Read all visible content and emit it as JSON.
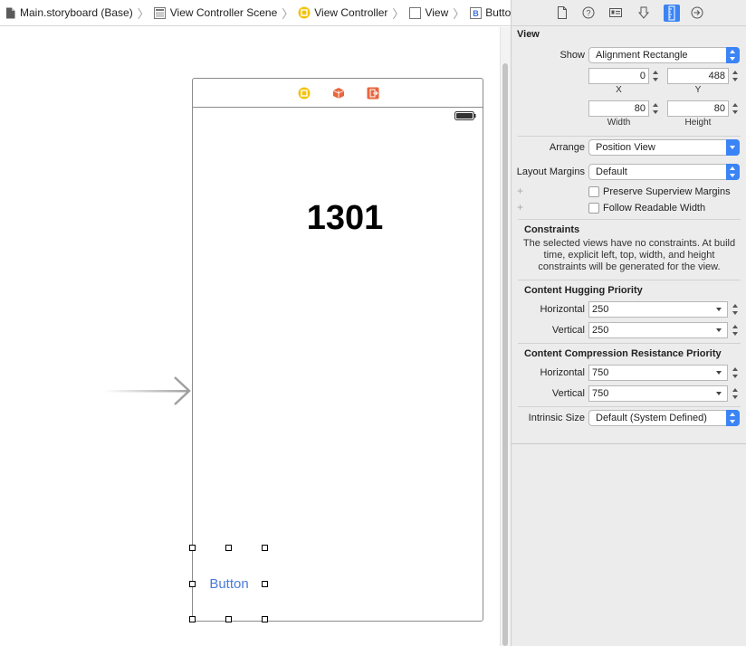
{
  "breadcrumb": {
    "items": [
      {
        "label": "Main.storyboard (Base)",
        "icon": "storyboard-file-icon"
      },
      {
        "label": "View Controller Scene",
        "icon": "scene-icon"
      },
      {
        "label": "View Controller",
        "icon": "view-controller-icon"
      },
      {
        "label": "View",
        "icon": "view-icon"
      },
      {
        "label": "Button",
        "icon": "button-b-icon"
      }
    ]
  },
  "canvas": {
    "counter_text": "1301",
    "button_text": "Button"
  },
  "inspector": {
    "toolbar_icons": [
      "file-inspector-icon",
      "quick-help-icon",
      "identity-inspector-icon",
      "attributes-inspector-icon",
      "size-inspector-icon",
      "connections-inspector-icon"
    ],
    "view_section": "View",
    "show_label": "Show",
    "show_value": "Alignment Rectangle",
    "x_value": "0",
    "y_value": "488",
    "x_label": "X",
    "y_label": "Y",
    "width_value": "80",
    "height_value": "80",
    "width_label": "Width",
    "height_label": "Height",
    "arrange_label": "Arrange",
    "arrange_value": "Position View",
    "layout_margins_label": "Layout Margins",
    "layout_margins_value": "Default",
    "preserve_superview": "Preserve Superview Margins",
    "follow_readable": "Follow Readable Width",
    "constraints_title": "Constraints",
    "constraints_desc": "The selected views have no constraints. At build time, explicit left, top, width, and height constraints will be generated for the view.",
    "hugging_title": "Content Hugging Priority",
    "hugging_horizontal_label": "Horizontal",
    "hugging_horizontal_value": "250",
    "hugging_vertical_label": "Vertical",
    "hugging_vertical_value": "250",
    "compression_title": "Content Compression Resistance Priority",
    "compression_horizontal_label": "Horizontal",
    "compression_horizontal_value": "750",
    "compression_vertical_label": "Vertical",
    "compression_vertical_value": "750",
    "intrinsic_label": "Intrinsic Size",
    "intrinsic_value": "Default (System Defined)"
  },
  "colors": {
    "accent_blue": "#3b84f5",
    "button_text": "#4a7bd8",
    "vc_icon": "#f4c20d",
    "orange_icon": "#e8663d"
  }
}
